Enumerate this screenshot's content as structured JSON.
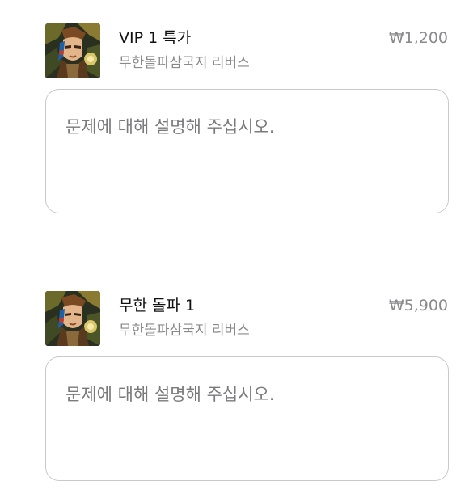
{
  "items": [
    {
      "title": "VIP 1 특가",
      "subtitle": "무한돌파삼국지 리버스",
      "price": "₩1,200",
      "thumbnail_icon": "game-app-icon",
      "description": {
        "value": "",
        "placeholder": "문제에 대해 설명해 주십시오."
      }
    },
    {
      "title": "무한 돌파 1",
      "subtitle": "무한돌파삼국지 리버스",
      "price": "₩5,900",
      "thumbnail_icon": "game-app-icon",
      "description": {
        "value": "",
        "placeholder": "문제에 대해 설명해 주십시오."
      }
    }
  ],
  "colors": {
    "title": "#111111",
    "secondary": "#8a8a8e",
    "border": "#c9c9cd",
    "placeholder": "#7a7a7e"
  }
}
